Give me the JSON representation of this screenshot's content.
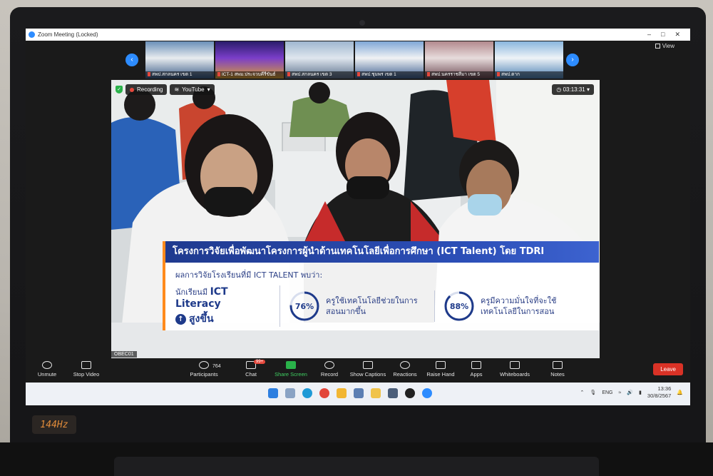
{
  "window": {
    "title": "Zoom Meeting (Locked)",
    "view_label": "View"
  },
  "thumbnails": [
    {
      "label": "สพป.สกลนคร เขต 1",
      "colors": [
        "#6a8fb8",
        "#e8ecef",
        "#3a5a86"
      ]
    },
    {
      "label": "ICT-1 สพม.ประจวบคีรีขันธ์",
      "colors": [
        "#2a1d6b",
        "#7b3ec9",
        "#d9a033"
      ]
    },
    {
      "label": "สพป.สกลนคร เขต 3",
      "colors": [
        "#9fb6cf",
        "#dfe6ee",
        "#5a6f8a"
      ]
    },
    {
      "label": "สพป.ชุมพร เขต 1",
      "colors": [
        "#7fa7d6",
        "#f0f2f4",
        "#3e5f90"
      ]
    },
    {
      "label": "สพป.นครราชสีมา เขต 5",
      "colors": [
        "#b38a8e",
        "#e7dcdc",
        "#6e4a54"
      ]
    },
    {
      "label": "สพป.ตาก",
      "colors": [
        "#89b6de",
        "#eef3f7",
        "#4b7fb3"
      ]
    }
  ],
  "recording": {
    "label": "Recording",
    "stream": "YouTube",
    "timer": "03:13:31"
  },
  "overlay": {
    "title": "โครงการวิจัยเพื่อพัฒนาโครงการผู้นำด้านเทคโนโลยีเพื่อการศึกษา (ICT Talent) โดย TDRI",
    "subtitle": "ผลการวิจัยโรงเรียนที่มี ICT TALENT พบว่า:",
    "stat1_prefix": "นักเรียนมี",
    "stat1_highlight": "ICT Literacy",
    "stat1_line2": "สูงขึ้น",
    "stat2_value": 76,
    "stat2_label": "76%",
    "stat2_desc": "ครูใช้เทคโนโลยีช่วยในการสอนมากขึ้น",
    "stat3_value": 88,
    "stat3_label": "88%",
    "stat3_desc": "ครูมีความมั่นใจที่จะใช้เทคโนโลยีในการสอน"
  },
  "video_owner": "OBEC01",
  "toolbar": {
    "unmute": "Unmute",
    "stop_video": "Stop Video",
    "participants": "Participants",
    "participants_count": "764",
    "chat": "Chat",
    "chat_badge": "99+",
    "share_screen": "Share Screen",
    "record": "Record",
    "show_captions": "Show Captions",
    "reactions": "Reactions",
    "raise_hand": "Raise Hand",
    "apps": "Apps",
    "whiteboards": "Whiteboards",
    "notes": "Notes",
    "leave": "Leave"
  },
  "taskbar": {
    "lang": "ENG",
    "time": "13:36",
    "date": "30/8/2567"
  },
  "laptop_badge": "144Hz",
  "colors": {
    "zoom_blue": "#2d8cff",
    "leave_red": "#d93226",
    "overlay_blue": "#1f3a8f",
    "overlay_orange": "#ff8a1c"
  }
}
